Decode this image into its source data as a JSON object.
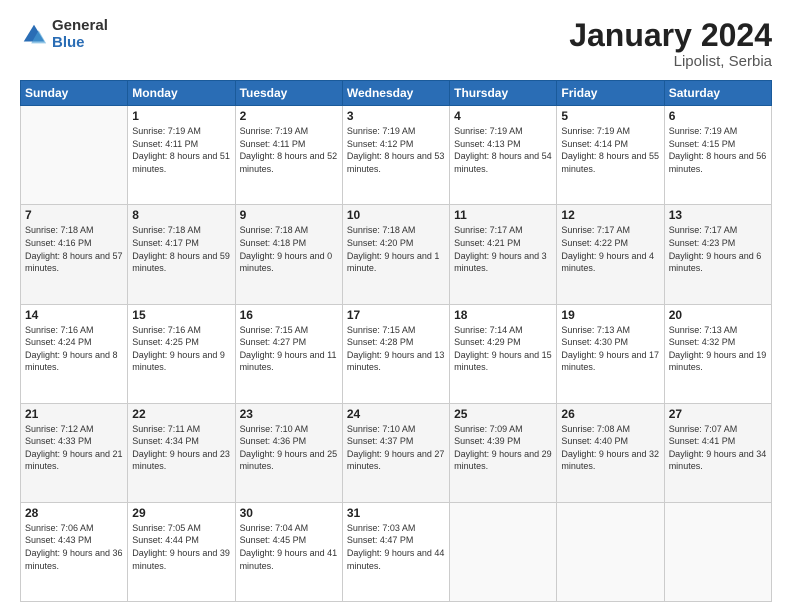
{
  "header": {
    "logo": {
      "general": "General",
      "blue": "Blue"
    },
    "title": "January 2024",
    "subtitle": "Lipolist, Serbia"
  },
  "calendar": {
    "days_of_week": [
      "Sunday",
      "Monday",
      "Tuesday",
      "Wednesday",
      "Thursday",
      "Friday",
      "Saturday"
    ],
    "weeks": [
      [
        {
          "day": "",
          "sunrise": "",
          "sunset": "",
          "daylight": ""
        },
        {
          "day": "1",
          "sunrise": "Sunrise: 7:19 AM",
          "sunset": "Sunset: 4:11 PM",
          "daylight": "Daylight: 8 hours and 51 minutes."
        },
        {
          "day": "2",
          "sunrise": "Sunrise: 7:19 AM",
          "sunset": "Sunset: 4:11 PM",
          "daylight": "Daylight: 8 hours and 52 minutes."
        },
        {
          "day": "3",
          "sunrise": "Sunrise: 7:19 AM",
          "sunset": "Sunset: 4:12 PM",
          "daylight": "Daylight: 8 hours and 53 minutes."
        },
        {
          "day": "4",
          "sunrise": "Sunrise: 7:19 AM",
          "sunset": "Sunset: 4:13 PM",
          "daylight": "Daylight: 8 hours and 54 minutes."
        },
        {
          "day": "5",
          "sunrise": "Sunrise: 7:19 AM",
          "sunset": "Sunset: 4:14 PM",
          "daylight": "Daylight: 8 hours and 55 minutes."
        },
        {
          "day": "6",
          "sunrise": "Sunrise: 7:19 AM",
          "sunset": "Sunset: 4:15 PM",
          "daylight": "Daylight: 8 hours and 56 minutes."
        }
      ],
      [
        {
          "day": "7",
          "sunrise": "Sunrise: 7:18 AM",
          "sunset": "Sunset: 4:16 PM",
          "daylight": "Daylight: 8 hours and 57 minutes."
        },
        {
          "day": "8",
          "sunrise": "Sunrise: 7:18 AM",
          "sunset": "Sunset: 4:17 PM",
          "daylight": "Daylight: 8 hours and 59 minutes."
        },
        {
          "day": "9",
          "sunrise": "Sunrise: 7:18 AM",
          "sunset": "Sunset: 4:18 PM",
          "daylight": "Daylight: 9 hours and 0 minutes."
        },
        {
          "day": "10",
          "sunrise": "Sunrise: 7:18 AM",
          "sunset": "Sunset: 4:20 PM",
          "daylight": "Daylight: 9 hours and 1 minute."
        },
        {
          "day": "11",
          "sunrise": "Sunrise: 7:17 AM",
          "sunset": "Sunset: 4:21 PM",
          "daylight": "Daylight: 9 hours and 3 minutes."
        },
        {
          "day": "12",
          "sunrise": "Sunrise: 7:17 AM",
          "sunset": "Sunset: 4:22 PM",
          "daylight": "Daylight: 9 hours and 4 minutes."
        },
        {
          "day": "13",
          "sunrise": "Sunrise: 7:17 AM",
          "sunset": "Sunset: 4:23 PM",
          "daylight": "Daylight: 9 hours and 6 minutes."
        }
      ],
      [
        {
          "day": "14",
          "sunrise": "Sunrise: 7:16 AM",
          "sunset": "Sunset: 4:24 PM",
          "daylight": "Daylight: 9 hours and 8 minutes."
        },
        {
          "day": "15",
          "sunrise": "Sunrise: 7:16 AM",
          "sunset": "Sunset: 4:25 PM",
          "daylight": "Daylight: 9 hours and 9 minutes."
        },
        {
          "day": "16",
          "sunrise": "Sunrise: 7:15 AM",
          "sunset": "Sunset: 4:27 PM",
          "daylight": "Daylight: 9 hours and 11 minutes."
        },
        {
          "day": "17",
          "sunrise": "Sunrise: 7:15 AM",
          "sunset": "Sunset: 4:28 PM",
          "daylight": "Daylight: 9 hours and 13 minutes."
        },
        {
          "day": "18",
          "sunrise": "Sunrise: 7:14 AM",
          "sunset": "Sunset: 4:29 PM",
          "daylight": "Daylight: 9 hours and 15 minutes."
        },
        {
          "day": "19",
          "sunrise": "Sunrise: 7:13 AM",
          "sunset": "Sunset: 4:30 PM",
          "daylight": "Daylight: 9 hours and 17 minutes."
        },
        {
          "day": "20",
          "sunrise": "Sunrise: 7:13 AM",
          "sunset": "Sunset: 4:32 PM",
          "daylight": "Daylight: 9 hours and 19 minutes."
        }
      ],
      [
        {
          "day": "21",
          "sunrise": "Sunrise: 7:12 AM",
          "sunset": "Sunset: 4:33 PM",
          "daylight": "Daylight: 9 hours and 21 minutes."
        },
        {
          "day": "22",
          "sunrise": "Sunrise: 7:11 AM",
          "sunset": "Sunset: 4:34 PM",
          "daylight": "Daylight: 9 hours and 23 minutes."
        },
        {
          "day": "23",
          "sunrise": "Sunrise: 7:10 AM",
          "sunset": "Sunset: 4:36 PM",
          "daylight": "Daylight: 9 hours and 25 minutes."
        },
        {
          "day": "24",
          "sunrise": "Sunrise: 7:10 AM",
          "sunset": "Sunset: 4:37 PM",
          "daylight": "Daylight: 9 hours and 27 minutes."
        },
        {
          "day": "25",
          "sunrise": "Sunrise: 7:09 AM",
          "sunset": "Sunset: 4:39 PM",
          "daylight": "Daylight: 9 hours and 29 minutes."
        },
        {
          "day": "26",
          "sunrise": "Sunrise: 7:08 AM",
          "sunset": "Sunset: 4:40 PM",
          "daylight": "Daylight: 9 hours and 32 minutes."
        },
        {
          "day": "27",
          "sunrise": "Sunrise: 7:07 AM",
          "sunset": "Sunset: 4:41 PM",
          "daylight": "Daylight: 9 hours and 34 minutes."
        }
      ],
      [
        {
          "day": "28",
          "sunrise": "Sunrise: 7:06 AM",
          "sunset": "Sunset: 4:43 PM",
          "daylight": "Daylight: 9 hours and 36 minutes."
        },
        {
          "day": "29",
          "sunrise": "Sunrise: 7:05 AM",
          "sunset": "Sunset: 4:44 PM",
          "daylight": "Daylight: 9 hours and 39 minutes."
        },
        {
          "day": "30",
          "sunrise": "Sunrise: 7:04 AM",
          "sunset": "Sunset: 4:45 PM",
          "daylight": "Daylight: 9 hours and 41 minutes."
        },
        {
          "day": "31",
          "sunrise": "Sunrise: 7:03 AM",
          "sunset": "Sunset: 4:47 PM",
          "daylight": "Daylight: 9 hours and 44 minutes."
        },
        {
          "day": "",
          "sunrise": "",
          "sunset": "",
          "daylight": ""
        },
        {
          "day": "",
          "sunrise": "",
          "sunset": "",
          "daylight": ""
        },
        {
          "day": "",
          "sunrise": "",
          "sunset": "",
          "daylight": ""
        }
      ]
    ]
  }
}
